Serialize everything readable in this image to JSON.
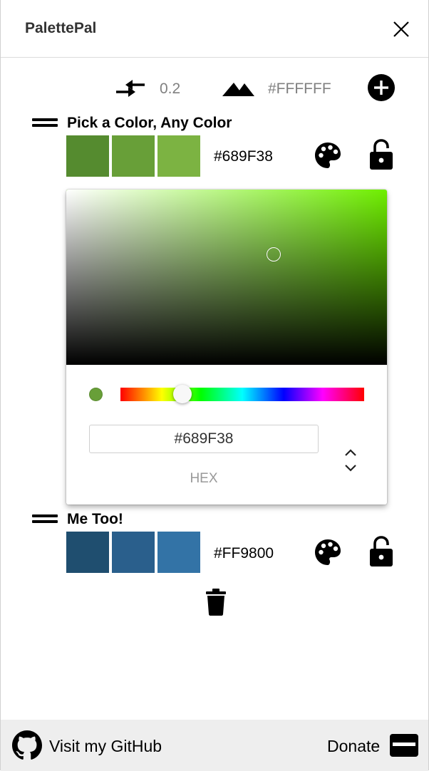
{
  "app": {
    "title": "PalettePal"
  },
  "toolbar": {
    "spacing_value": "0.2",
    "background_value": "#FFFFFF",
    "icons": {
      "spacing": "arrows-compress-icon",
      "background": "mountains-icon",
      "add": "plus-circle-icon"
    }
  },
  "palettes": [
    {
      "title": "Pick a Color, Any Color",
      "hex": "#689F38",
      "swatches": [
        "#558B2F",
        "#689F38",
        "#7CB342"
      ]
    },
    {
      "title": "Me Too!",
      "hex": "#FF9800",
      "swatches": [
        "#1F4E6F",
        "#2A5F8C",
        "#3373A6"
      ]
    }
  ],
  "picker": {
    "hex_value": "#689F38",
    "format_label": "HEX",
    "hue_color": "#6FEF00",
    "current_color": "#689F38",
    "hue_degrees": 91
  },
  "footer": {
    "github_label": "Visit my GitHub",
    "donate_label": "Donate"
  }
}
